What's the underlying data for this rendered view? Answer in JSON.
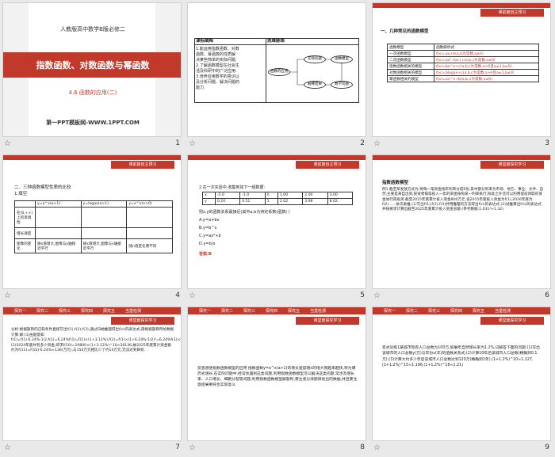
{
  "slides": [
    {
      "num": "1",
      "top": "人教版高中数学B版必修二",
      "title": "指数函数、对数函数与幂函数",
      "sub": "4.6    函数的应用(二)",
      "site": "第一PPT模板网-WWW.1PPT.COM"
    },
    {
      "num": "2",
      "h1": "课标阐释",
      "h2": "思维脉络",
      "lines": [
        "1.能运用指数函数、对数",
        "函数、幂函数的性质解",
        "决某些简单的实际问题.",
        "2.了解函数模型在社会生",
        "活及科研中的广泛应用.",
        "3.培养应用数学的意识以",
        "及分析问题、解决问题的",
        "能力."
      ],
      "ovals": [
        "函数的应用",
        "实际问题",
        "函数模型",
        "解释结果",
        "数学问题"
      ]
    },
    {
      "num": "3",
      "tag": "课前篇自主预习",
      "heading": "一、几种常见的函数模型",
      "cols": [
        "函数模型",
        "函数解析式"
      ],
      "rows": [
        [
          "一次函数模型",
          "f(x)=ax+b(a,b为常数,a≠0)"
        ],
        [
          "二次函数模型",
          "f(x)=ax²+bx+c(a,b,c为常数,a≠0)"
        ],
        [
          "指数函数相关的模型",
          "f(x)=ba^x+c(a,b,c为常数,a>0且a≠1,b≠0)"
        ],
        [
          "对数函数相关的模型",
          "f(x)=blogax+c(a,b,c为常数,a>0且a≠1,b≠0)"
        ],
        [
          "幂函数相关的模型",
          "f(x)=ax^n+b(a,b,n为常数,a≠0)"
        ]
      ]
    },
    {
      "num": "4",
      "tag": "课前篇自主预习",
      "heading": "二、三种函数模型性质的比较",
      "sub": "1.填空",
      "cols": [
        "",
        "y=a^x(a>1)",
        "y=logax(a>1)",
        "y=x^n(n>0)"
      ],
      "rows": [
        [
          "在(0,+∞)上的单调性",
          "",
          "",
          ""
        ],
        [
          "增长速度",
          "",
          "",
          ""
        ],
        [
          "图像的变化",
          "随x值增大,图像与y轴接近平行",
          "随x值增大,图像与x轴接近平行",
          "随n值变化而不同"
        ]
      ]
    },
    {
      "num": "5",
      "tag": "课前篇自主预习",
      "q": "2.在一次实验中,收集到如下一组数据:",
      "rx": [
        "x",
        "-2.0",
        "-1.0",
        "0",
        "1.00",
        "2.00",
        "3.00"
      ],
      "ry": [
        "y",
        "0.24",
        "0.51",
        "1",
        "2.02",
        "3.98",
        "8.02"
      ],
      "q2": "则x,y的函数关系最接近(其中a,b为待定系数)函数(    )",
      "opts": [
        "A.y=a+bx",
        "B.y=b^x",
        "C.y=ax²+b",
        "D.y=b/x"
      ],
      "ans": "答案:B"
    },
    {
      "num": "6",
      "tag": "课堂篇探究学习",
      "heading": "指数函数模型",
      "body": "例1 截至某发放方式为:将每一笔资金按年利率分成6份,其中部分利率为市场、地方、事业、文件、自然,主要是来自出资,投资者每笔投入一年的资金按照某一利率执行,除此之外还可以利用提前领取的资金进行再投资.截至2015年底累计投入资金800万元.设2015年底投入资金为f(1),2016年底为f(2)……依次类推.(1)写出f(1),f(2),f(3)并用推理的方法得出f(n)的表达式.(2)试推算出f(n)的表达式并按要求计算出截至2025年底累计投入资金总额.(参考数据:1.031²≈1.32)"
    },
    {
      "num": "7",
      "tag": "课堂篇探究学习",
      "nav": [
        "探究一",
        "探究二",
        "探究三",
        "探究四",
        "探究五",
        "当堂检测"
      ],
      "body": "分析:根据题目的已知条件直接写出f(1),f(2),f(3),通过归纳推理得出f(n)的表达式,再根据题目所给数据计算.解:(1)由题意知f(1)=f(1)·6.24%·1/2,f(1)=6.24%f(1)=f(1)×(1+3.12%),f(2)=f(1)×(1+6.24%·1/2)²=6.24%f(1)×(1+3.12%)²,f(3)=f(1)×(1+3.12%)³,……,f(n)=19800×(1+3.12%)^n(n∈N+).(2)2024年底共有多少资金,即求f(10)=19800×(1+3.12%)^10≈26136,故2025年底累计资金额约为f(11)=f(10)·6.24%≈136(万元),与150万元相比少了约14万元,无法达到目标."
    },
    {
      "num": "8",
      "tag": "课堂篇探究学习",
      "nav": [
        "探究一",
        "探究二",
        "探究三",
        "探究四",
        "探究五",
        "当堂检测"
      ],
      "body": "反思感悟指数函数模型的应用 指数函数y=a^x(a>1)的增长速度随x的增大而越来越快,称为爆炸式增长.在实际问题中,经常会遇到这类问题,利用指数函数模型可以解决这类问题,常涉及增长率、人口增长、细胞分裂等问题,利用指数函数模型解题时,要注意分清题目给出的数据,并且要注意结果要符合实际意义."
    },
    {
      "num": "9",
      "tag": "课堂篇探究学习",
      "nav": [
        "探究一",
        "探究二",
        "探究三",
        "探究四",
        "探究五",
        "当堂检测"
      ],
      "body": "变式训练1某城市现有人口总数为100万,如果年自然增长率为1.2%,试解答下面的问题:(1)写出该城市的人口总数y(万)与年份x(年)的函数关系式;(2)计算10年后该城市人口总数(精确到0.1万);(3)计算大约多少年后该城市人口总数达到120万(精确到1年).(1+1.2%)^10≈1.127,(1+1.2%)^15≈1.196,(1+1.2%)^16≈1.21)"
    }
  ]
}
